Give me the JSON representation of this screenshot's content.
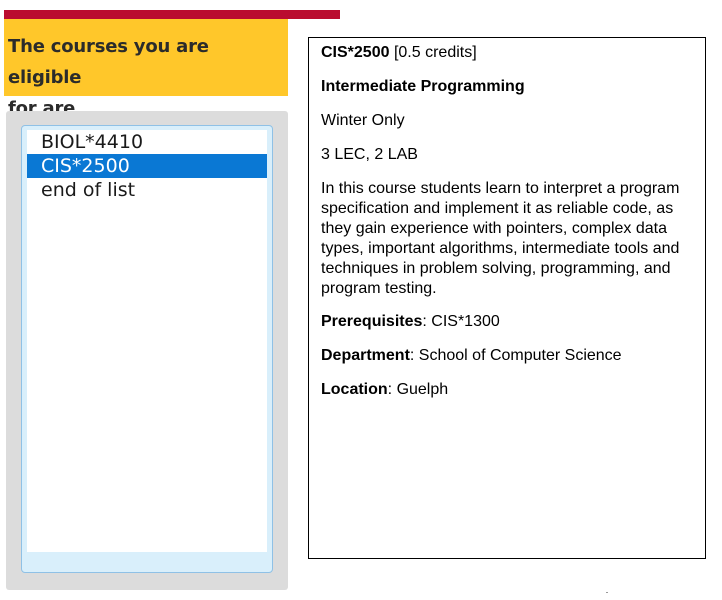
{
  "colors": {
    "accent_red": "#ba0c2f",
    "heading_yellow": "#ffc72a",
    "selection_blue": "#0a78d4"
  },
  "heading": {
    "line1": "The courses you are eligible",
    "line2": "for are"
  },
  "course_list": {
    "items": [
      "BIOL*4410",
      "CIS*2500",
      "end of list"
    ],
    "selected": "CIS*2500"
  },
  "course_detail": {
    "code": "CIS*2500",
    "credits": "[0.5 credits]",
    "title": "Intermediate Programming",
    "offering": "Winter Only",
    "format": "3 LEC, 2 LAB",
    "description": "In this course students learn to interpret a program specification and implement it as reliable code, as they gain experience with pointers, complex data types, important algorithms, intermediate tools and techniques in problem solving, programming, and program testing.",
    "prerequisites_label": "Prerequisites",
    "prerequisites": "CIS*1300",
    "department_label": "Department",
    "department": "School of Computer Science",
    "location_label": "Location",
    "location": "Guelph"
  }
}
